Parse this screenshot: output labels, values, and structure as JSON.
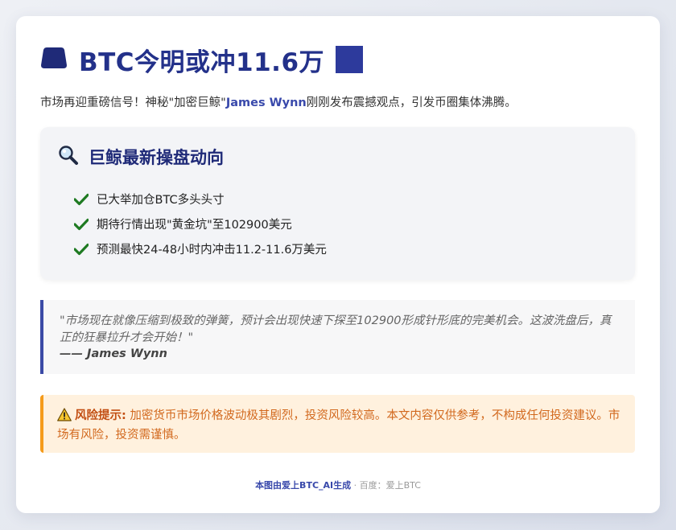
{
  "header": {
    "title": "BTC今明或冲11.6万",
    "icon": "hat-icon",
    "accent": "#23318a"
  },
  "intro": {
    "before": "市场再迎重磅信号！神秘\"加密巨鲸\"",
    "name": "James Wynn",
    "after": "刚刚发布震撼观点，引发币圈集体沸腾。"
  },
  "whale_panel": {
    "icon": "magnifier-icon",
    "title": "巨鲸最新操盘动向",
    "items": [
      {
        "icon": "check-icon",
        "text": "已大举加仓BTC多头头寸"
      },
      {
        "icon": "check-icon",
        "text": "期待行情出现\"黄金坑\"至102900美元"
      },
      {
        "icon": "check-icon",
        "text": "预测最快24-48小时内冲击11.2-11.6万美元"
      }
    ]
  },
  "quote": {
    "text": "\"市场现在就像压缩到极致的弹簧，预计会出现快速下探至102900形成针形底的完美机会。这波洗盘后，真正的狂暴拉升才会开始！\"",
    "author": "—— James Wynn"
  },
  "risk": {
    "icon": "warning-icon",
    "label": "风险提示:",
    "text": "加密货币市场价格波动极其剧烈，投资风险较高。本文内容仅供参考，不构成任何投资建议。市场有风险，投资需谨慎。",
    "color": "#f59b1b"
  },
  "footer": {
    "generated": "本图由爱上BTC_AI生成",
    "source": " · 百度：爱上BTC"
  }
}
